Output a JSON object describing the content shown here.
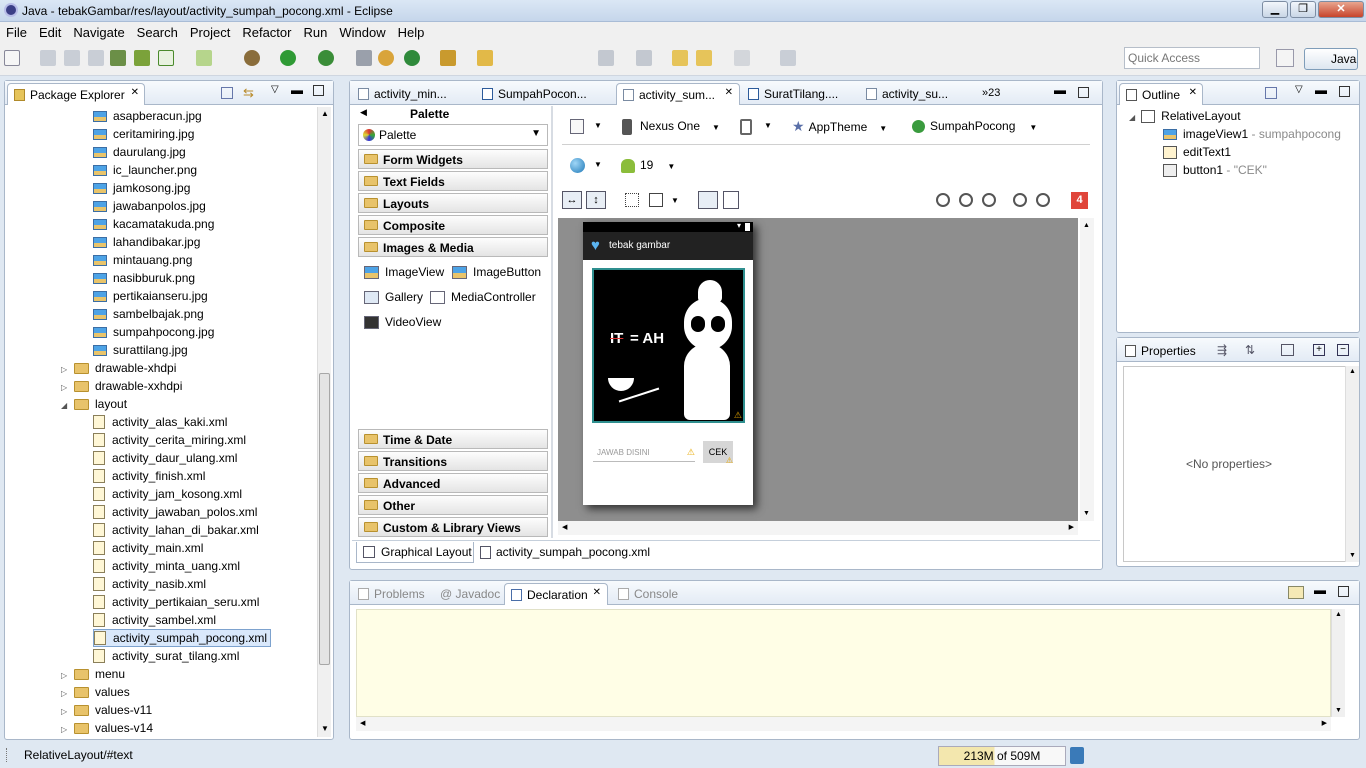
{
  "window": {
    "title": "Java - tebakGambar/res/layout/activity_sumpah_pocong.xml - Eclipse"
  },
  "menu": [
    "File",
    "Edit",
    "Navigate",
    "Search",
    "Project",
    "Refactor",
    "Run",
    "Window",
    "Help"
  ],
  "quick_access": {
    "placeholder": "Quick Access"
  },
  "perspective": {
    "label": "Java"
  },
  "package_explorer": {
    "title": "Package Explorer",
    "images": [
      "asapberacun.jpg",
      "ceritamiring.jpg",
      "daurulang.jpg",
      "ic_launcher.png",
      "jamkosong.jpg",
      "jawabanpolos.jpg",
      "kacamatakuda.png",
      "lahandibakar.jpg",
      "mintauang.png",
      "nasibburuk.png",
      "pertikaianseru.jpg",
      "sambelbajak.png",
      "sumpahpocong.jpg",
      "surattilang.jpg"
    ],
    "folders_a": [
      "drawable-xhdpi",
      "drawable-xxhdpi"
    ],
    "layout_folder": "layout",
    "layouts": [
      "activity_alas_kaki.xml",
      "activity_cerita_miring.xml",
      "activity_daur_ulang.xml",
      "activity_finish.xml",
      "activity_jam_kosong.xml",
      "activity_jawaban_polos.xml",
      "activity_lahan_di_bakar.xml",
      "activity_main.xml",
      "activity_minta_uang.xml",
      "activity_nasib.xml",
      "activity_pertikaian_seru.xml",
      "activity_sambel.xml",
      "activity_sumpah_pocong.xml",
      "activity_surat_tilang.xml"
    ],
    "selected": "activity_sumpah_pocong.xml",
    "folders_b": [
      "menu",
      "values",
      "values-v11",
      "values-v14"
    ]
  },
  "editor_tabs": [
    "activity_min...",
    "SumpahPocon...",
    "activity_sum...",
    "SuratTilang....",
    "activity_su...",
    "»23"
  ],
  "palette": {
    "title": "Palette",
    "dropdown": "Palette",
    "categories_top": [
      "Form Widgets",
      "Text Fields",
      "Layouts",
      "Composite",
      "Images & Media"
    ],
    "items": [
      "ImageView",
      "ImageButton",
      "Gallery",
      "MediaController",
      "VideoView"
    ],
    "categories_bottom": [
      "Time & Date",
      "Transitions",
      "Advanced",
      "Other",
      "Custom & Library Views"
    ]
  },
  "layout_toolbar": {
    "device": "Nexus One",
    "theme": "AppTheme",
    "activity": "SumpahPocong",
    "api": "19",
    "error_count": "4"
  },
  "phone": {
    "app_title": "tebak gambar",
    "puzzle_text_1": "IT",
    "puzzle_text_2": "= AH",
    "input_hint": "JAWAB DISINI",
    "button": "CEK"
  },
  "editor_bottom_tabs": [
    "Graphical Layout",
    "activity_sumpah_pocong.xml"
  ],
  "outline": {
    "title": "Outline",
    "root": "RelativeLayout",
    "children": [
      {
        "name": "imageView1",
        "detail": " - sumpahpocong"
      },
      {
        "name": "editText1",
        "detail": ""
      },
      {
        "name": "button1",
        "detail": " - \"CEK\""
      }
    ]
  },
  "properties": {
    "title": "Properties",
    "empty": "<No properties>"
  },
  "bottom_tabs": [
    "Problems",
    "@ Javadoc",
    "Declaration",
    "Console"
  ],
  "status": {
    "left": "RelativeLayout/#text",
    "heap": "213M of 509M"
  }
}
